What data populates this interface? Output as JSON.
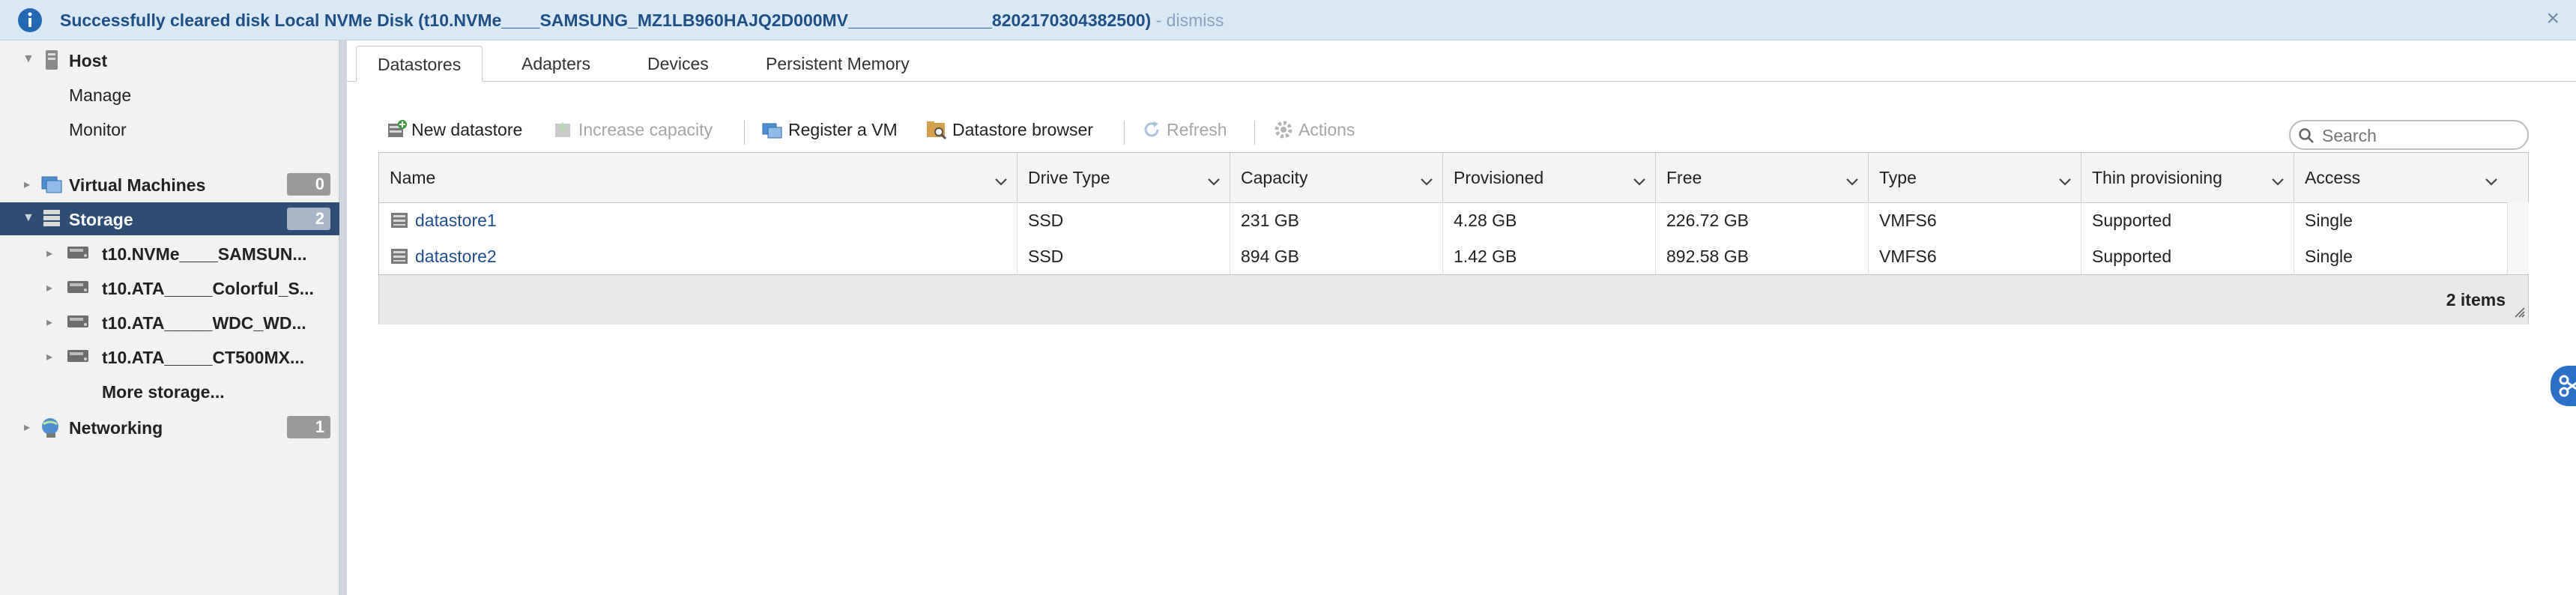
{
  "banner": {
    "message": "Successfully cleared disk Local NVMe Disk (t10.NVMe____SAMSUNG_MZ1LB960HAJQ2D000MV_______________8202170304382500)",
    "dismiss": " - dismiss",
    "close": "×"
  },
  "nav": {
    "host": "Host",
    "manage": "Manage",
    "monitor": "Monitor",
    "virtual_machines": {
      "label": "Virtual Machines",
      "count": "0"
    },
    "storage": {
      "label": "Storage",
      "count": "2"
    },
    "disks": [
      "t10.NVMe____SAMSUN...",
      "t10.ATA_____Colorful_S...",
      "t10.ATA_____WDC_WD...",
      "t10.ATA_____CT500MX..."
    ],
    "more_storage": "More storage...",
    "networking": {
      "label": "Networking",
      "count": "1"
    }
  },
  "tabs": [
    "Datastores",
    "Adapters",
    "Devices",
    "Persistent Memory"
  ],
  "toolbar": {
    "new_datastore": "New datastore",
    "increase_capacity": "Increase capacity",
    "register_vm": "Register a VM",
    "datastore_browser": "Datastore browser",
    "refresh": "Refresh",
    "actions": "Actions",
    "search_placeholder": "Search"
  },
  "grid": {
    "columns": [
      "Name",
      "Drive Type",
      "Capacity",
      "Provisioned",
      "Free",
      "Type",
      "Thin provisioning",
      "Access"
    ],
    "rows": [
      [
        "datastore1",
        "SSD",
        "231 GB",
        "4.28 GB",
        "226.72 GB",
        "VMFS6",
        "Supported",
        "Single"
      ],
      [
        "datastore2",
        "SSD",
        "894 GB",
        "1.42 GB",
        "892.58 GB",
        "VMFS6",
        "Supported",
        "Single"
      ]
    ],
    "footer": "2 items"
  },
  "colors": {
    "banner_bg": "#d8e8f5",
    "banner_text": "#1e4f86",
    "nav_selected": "#2e4d74",
    "link": "#1f4e8c"
  }
}
